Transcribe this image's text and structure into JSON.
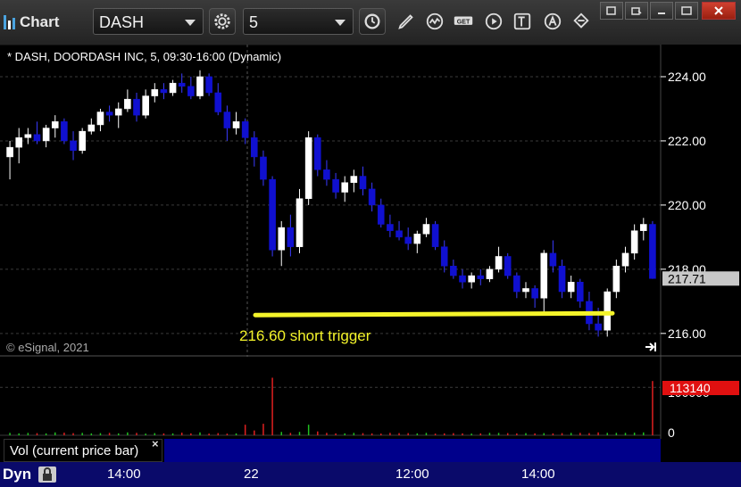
{
  "toolbar": {
    "title": "Chart",
    "symbol": "DASH",
    "interval": "5"
  },
  "chart": {
    "header": "* DASH, DOORDASH INC, 5, 09:30-16:00 (Dynamic)",
    "copyright": "© eSignal, 2021",
    "annotation": "216.60 short trigger",
    "last_price": "217.71",
    "price_ticks": [
      "224.00",
      "222.00",
      "220.00",
      "218.00",
      "216.00"
    ],
    "volume_label": "Vol (current price bar)",
    "volume_value": "113140",
    "volume_ticks": [
      "100000",
      "0"
    ],
    "dyn_label": "Dyn",
    "time_ticks": [
      "14:00",
      "22",
      "12:00",
      "14:00"
    ]
  },
  "colors": {
    "up": "#ffffff",
    "down": "#1010d0",
    "trigger_line": "#f4f42a",
    "annotation": "#f4f42a",
    "last_price_bg": "#c8c8c8",
    "volume_value_bg": "#e01010",
    "axis_bg": "#0a0a6a"
  },
  "chart_data": {
    "type": "candlestick",
    "price_ylim": [
      215.3,
      225.0
    ],
    "volume_ylim": [
      0,
      160000
    ],
    "trigger_level": 216.6,
    "last_price": 217.71,
    "candles": [
      [
        221.5,
        222.0,
        220.8,
        221.8
      ],
      [
        221.8,
        222.4,
        221.3,
        222.1
      ],
      [
        222.1,
        222.4,
        221.9,
        222.2
      ],
      [
        222.2,
        222.6,
        221.9,
        222.0
      ],
      [
        222.0,
        222.5,
        221.8,
        222.4
      ],
      [
        222.4,
        222.8,
        222.1,
        222.6
      ],
      [
        222.6,
        222.7,
        221.9,
        222.0
      ],
      [
        222.0,
        222.3,
        221.4,
        221.7
      ],
      [
        221.7,
        222.4,
        221.6,
        222.3
      ],
      [
        222.3,
        222.7,
        222.2,
        222.5
      ],
      [
        222.5,
        223.0,
        222.3,
        222.9
      ],
      [
        222.9,
        223.1,
        222.6,
        222.8
      ],
      [
        222.8,
        223.2,
        222.4,
        223.0
      ],
      [
        223.0,
        223.6,
        222.9,
        223.3
      ],
      [
        223.3,
        223.5,
        222.6,
        222.8
      ],
      [
        222.8,
        223.6,
        222.7,
        223.4
      ],
      [
        223.4,
        223.8,
        223.2,
        223.6
      ],
      [
        223.6,
        223.8,
        223.3,
        223.5
      ],
      [
        223.5,
        223.9,
        223.4,
        223.8
      ],
      [
        223.8,
        224.1,
        223.5,
        223.7
      ],
      [
        223.7,
        224.0,
        223.3,
        223.4
      ],
      [
        223.4,
        224.2,
        223.3,
        224.0
      ],
      [
        224.0,
        224.1,
        223.4,
        223.5
      ],
      [
        223.5,
        223.8,
        222.8,
        222.9
      ],
      [
        222.9,
        223.1,
        222.0,
        222.4
      ],
      [
        222.4,
        222.9,
        222.2,
        222.6
      ],
      [
        222.6,
        222.7,
        221.9,
        222.1
      ],
      [
        222.1,
        222.3,
        221.2,
        221.5
      ],
      [
        221.5,
        221.7,
        220.6,
        220.8
      ],
      [
        220.8,
        220.9,
        218.4,
        218.6
      ],
      [
        218.6,
        219.5,
        218.1,
        219.3
      ],
      [
        219.3,
        219.7,
        218.4,
        218.7
      ],
      [
        218.7,
        220.5,
        218.5,
        220.2
      ],
      [
        220.2,
        222.3,
        220.0,
        222.1
      ],
      [
        222.1,
        222.2,
        220.9,
        221.1
      ],
      [
        221.1,
        221.4,
        220.6,
        220.8
      ],
      [
        220.8,
        221.0,
        220.2,
        220.4
      ],
      [
        220.4,
        220.9,
        220.1,
        220.7
      ],
      [
        220.7,
        221.1,
        220.4,
        220.9
      ],
      [
        220.9,
        221.2,
        220.3,
        220.5
      ],
      [
        220.5,
        220.7,
        219.8,
        220.0
      ],
      [
        220.0,
        220.2,
        219.3,
        219.4
      ],
      [
        219.4,
        219.7,
        219.0,
        219.2
      ],
      [
        219.2,
        219.5,
        218.9,
        219.0
      ],
      [
        219.0,
        219.3,
        218.6,
        218.8
      ],
      [
        218.8,
        219.2,
        218.5,
        219.1
      ],
      [
        219.1,
        219.6,
        219.0,
        219.4
      ],
      [
        219.4,
        219.5,
        218.6,
        218.7
      ],
      [
        218.7,
        218.9,
        217.9,
        218.1
      ],
      [
        218.1,
        218.3,
        217.7,
        217.8
      ],
      [
        217.8,
        218.0,
        217.4,
        217.6
      ],
      [
        217.6,
        217.9,
        217.4,
        217.8
      ],
      [
        217.8,
        218.0,
        217.5,
        217.7
      ],
      [
        217.7,
        218.1,
        217.6,
        218.0
      ],
      [
        218.0,
        218.7,
        217.9,
        218.4
      ],
      [
        218.4,
        218.5,
        217.7,
        217.8
      ],
      [
        217.8,
        217.9,
        217.1,
        217.3
      ],
      [
        217.3,
        217.6,
        217.1,
        217.4
      ],
      [
        217.4,
        217.5,
        216.8,
        217.1
      ],
      [
        217.1,
        218.6,
        216.6,
        218.5
      ],
      [
        218.5,
        218.9,
        217.9,
        218.1
      ],
      [
        218.1,
        218.3,
        217.1,
        217.3
      ],
      [
        217.3,
        217.8,
        217.1,
        217.6
      ],
      [
        217.6,
        217.7,
        216.8,
        217.0
      ],
      [
        217.0,
        217.3,
        216.1,
        216.3
      ],
      [
        216.3,
        216.8,
        215.9,
        216.1
      ],
      [
        216.1,
        217.4,
        215.9,
        217.3
      ],
      [
        217.3,
        218.3,
        217.1,
        218.1
      ],
      [
        218.1,
        218.7,
        217.9,
        218.5
      ],
      [
        218.5,
        219.4,
        218.3,
        219.2
      ],
      [
        219.2,
        219.6,
        218.9,
        219.4
      ],
      [
        219.4,
        219.5,
        217.7,
        217.71
      ]
    ],
    "volumes": [
      5000,
      4000,
      5000,
      4500,
      4000,
      6000,
      5500,
      4500,
      5000,
      4000,
      4500,
      5000,
      4000,
      6000,
      5000,
      3500,
      4500,
      4000,
      4000,
      5500,
      4000,
      6000,
      3500,
      4500,
      3500,
      4000,
      22000,
      10000,
      24000,
      120000,
      7000,
      5000,
      7000,
      22000,
      8000,
      5000,
      4000,
      4000,
      5000,
      4500,
      4000,
      3500,
      5000,
      4500,
      4500,
      4000,
      5000,
      3500,
      4000,
      4500,
      4000,
      3500,
      4000,
      5000,
      5000,
      4500,
      4000,
      4500,
      4000,
      4500,
      4000,
      4500,
      5000,
      5000,
      4500,
      6000,
      5000,
      5000,
      5000,
      5500,
      6000,
      113140
    ]
  }
}
